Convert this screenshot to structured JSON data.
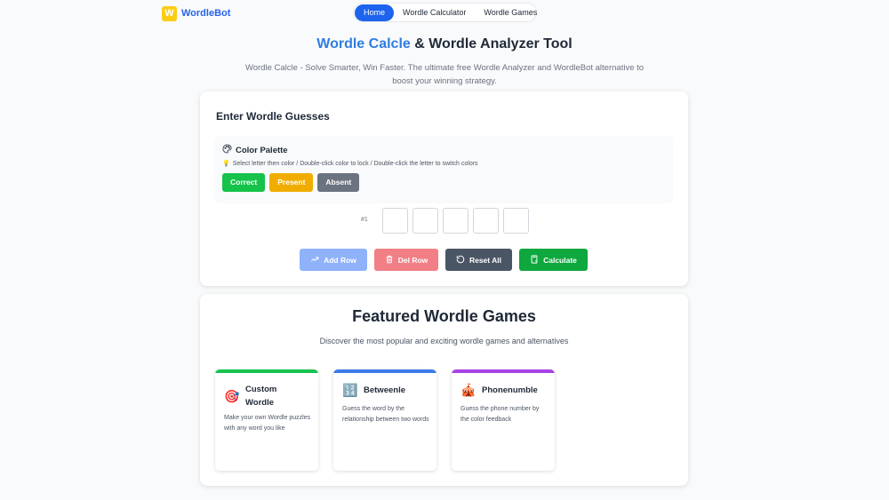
{
  "header": {
    "logo_letter": "W",
    "brand": "WordleBot",
    "nav": [
      {
        "label": "Home",
        "active": true
      },
      {
        "label": "Wordle Calculator",
        "active": false
      },
      {
        "label": "Wordle Games",
        "active": false
      }
    ]
  },
  "hero": {
    "title_accent": "Wordle Calcle",
    "title_rest": " & Wordle Analyzer Tool",
    "description": "Wordle Calcle - Solve Smarter, Win Faster. The ultimate free Wordle Analyzer and WordleBot alternative to boost your winning strategy."
  },
  "guesses": {
    "title": "Enter Wordle Guesses",
    "palette": {
      "title": "Color Palette",
      "icon": "palette-icon",
      "hint_icon": "lightbulb-icon",
      "hint": "Select letter then color / Double-click color to lock / Double-click the letter to switch colors",
      "colors": [
        {
          "label": "Correct",
          "color": "#15c24a"
        },
        {
          "label": "Present",
          "color": "#f0ad00"
        },
        {
          "label": "Absent",
          "color": "#6b7280"
        }
      ]
    },
    "row_label": "#1",
    "tile_count": 5,
    "actions": [
      {
        "label": "Add Row",
        "icon": "trend-up-icon",
        "color": "#8fb2fb"
      },
      {
        "label": "Del Row",
        "icon": "trash-icon",
        "color": "#f27f86"
      },
      {
        "label": "Reset All",
        "icon": "reset-icon",
        "color": "#4a5565"
      },
      {
        "label": "Calculate",
        "icon": "calculator-icon",
        "color": "#0ea83e"
      }
    ]
  },
  "games": {
    "title": "Featured Wordle Games",
    "subtitle": "Discover the most popular and exciting wordle games and alternatives",
    "items": [
      {
        "name": "Custom Wordle",
        "icon": "target-icon",
        "glyph": "🎯",
        "stripe": "#16c44e",
        "desc": "Make your own Wordle puzzles with any word you like"
      },
      {
        "name": "Betweenle",
        "icon": "numbers-icon",
        "glyph": "🔢",
        "stripe": "#3b7ae8",
        "desc": "Guess the word by the relationship between two words"
      },
      {
        "name": "Phonenumble",
        "icon": "circus-tent-icon",
        "glyph": "🎪",
        "stripe": "#a743e6",
        "desc": "Guess the phone number by the color feedback"
      }
    ]
  }
}
